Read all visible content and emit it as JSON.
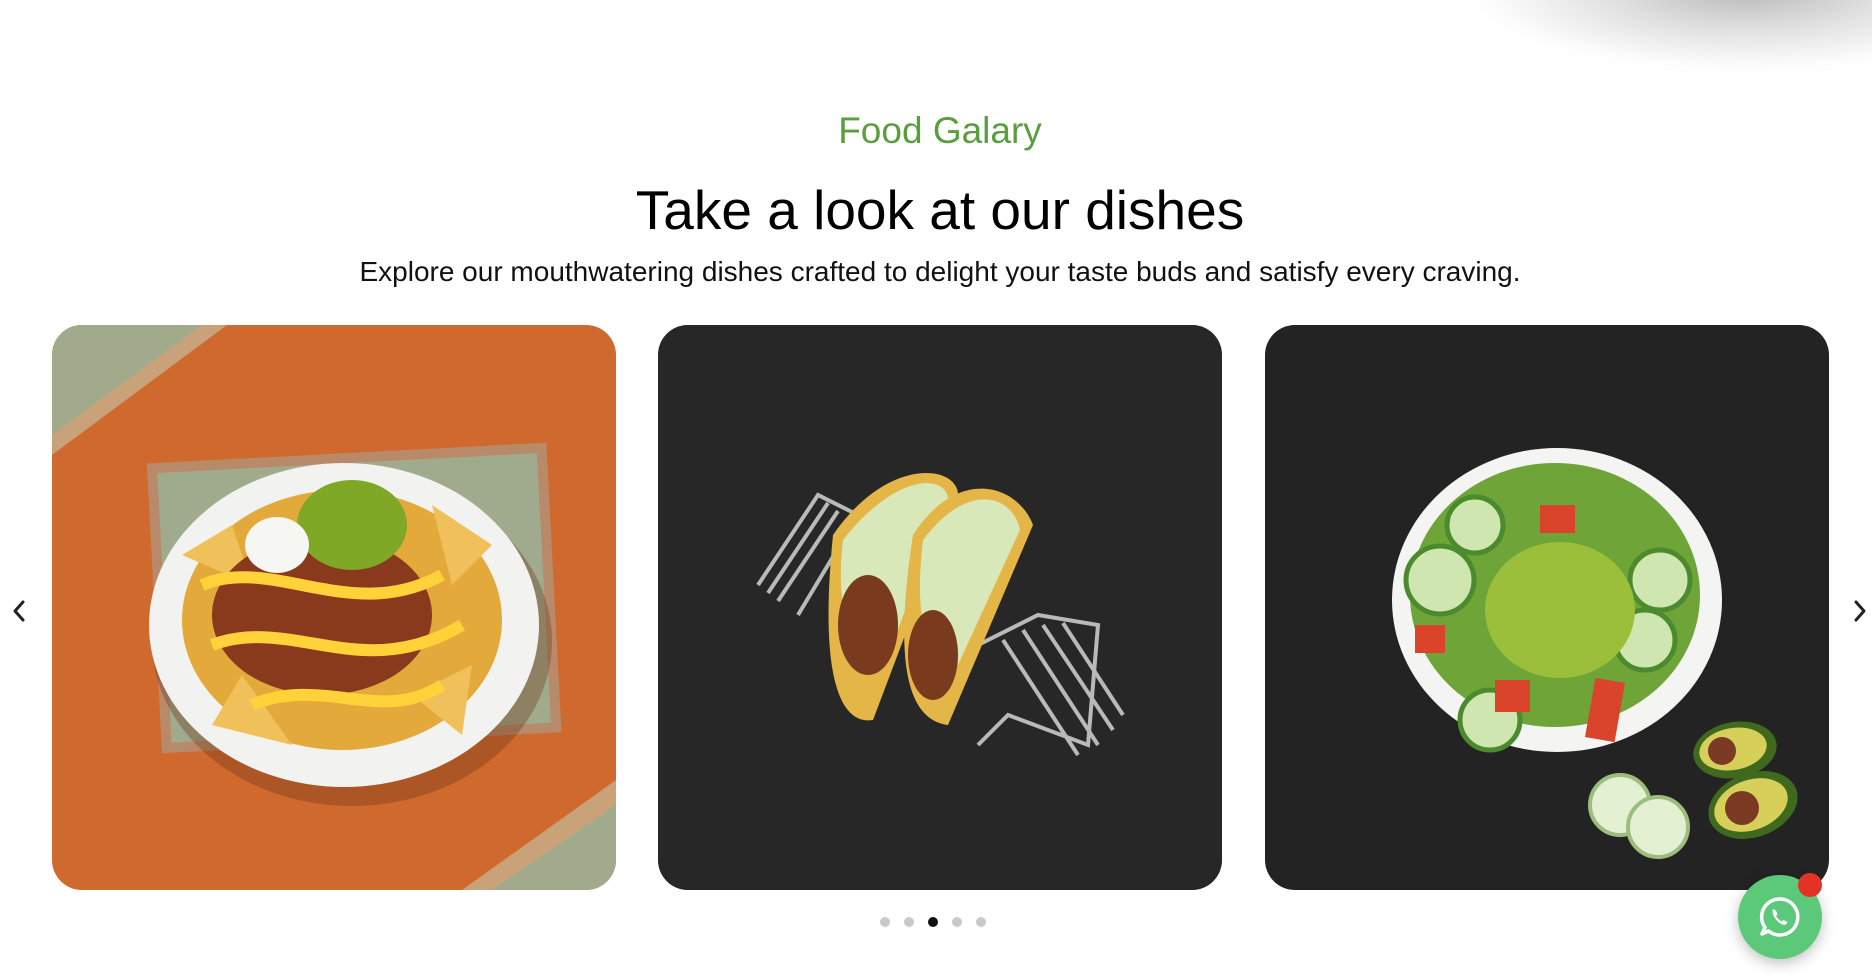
{
  "section": {
    "eyebrow": "Food Galary",
    "heading": "Take a look at our dishes",
    "subheading": "Explore our mouthwatering dishes crafted to delight your taste buds and satisfy every craving."
  },
  "carousel": {
    "slides": [
      {
        "name": "nachos-image",
        "background": "#d0692e"
      },
      {
        "name": "tacos-image",
        "background": "#222222"
      },
      {
        "name": "salad-image",
        "background": "#222222"
      }
    ],
    "prev_icon": "chevron-left-icon",
    "next_icon": "chevron-right-icon",
    "dot_count": 5,
    "active_dot": 3
  },
  "colors": {
    "accent_green": "#5a9e3e",
    "whatsapp_green": "#5cc97a",
    "notification_red": "#e53226"
  },
  "floating": {
    "whatsapp_icon": "whatsapp-icon"
  }
}
